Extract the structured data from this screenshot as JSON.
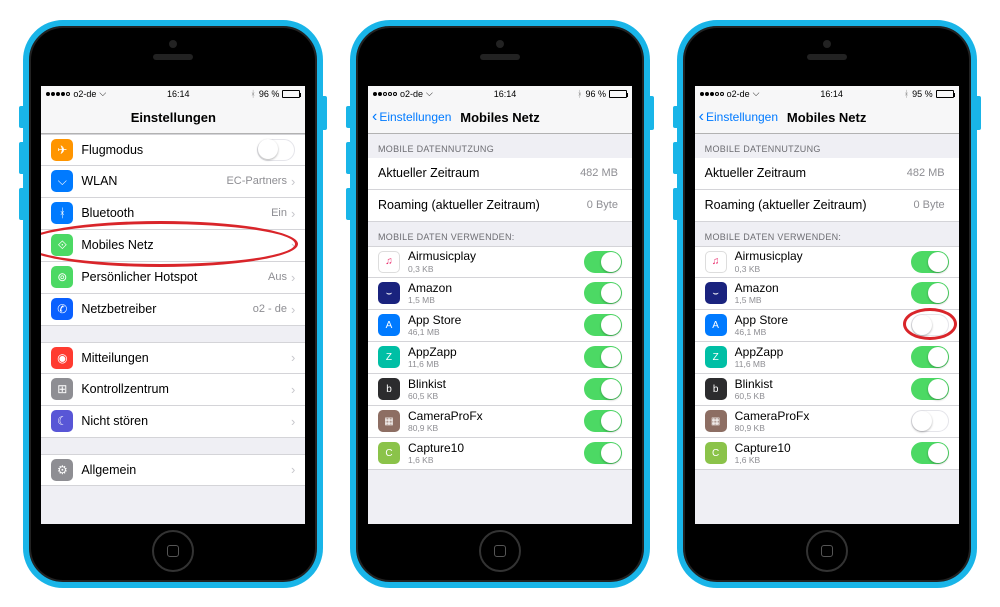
{
  "statusbar": {
    "carrier": "o2-de",
    "time": "16:14",
    "battery1": "96 %",
    "battery3": "95 %",
    "signal1": 4,
    "signal2": 2,
    "signal3": 3
  },
  "phone1": {
    "title": "Einstellungen",
    "rows": {
      "airplane": "Flugmodus",
      "wifi": "WLAN",
      "wifi_value": "EC-Partners",
      "bluetooth": "Bluetooth",
      "bluetooth_value": "Ein",
      "cellular": "Mobiles Netz",
      "hotspot": "Persönlicher Hotspot",
      "hotspot_value": "Aus",
      "carrier": "Netzbetreiber",
      "carrier_value": "o2 - de",
      "notifications": "Mitteilungen",
      "control": "Kontrollzentrum",
      "dnd": "Nicht stören",
      "general": "Allgemein"
    }
  },
  "phone2and3": {
    "back": "Einstellungen",
    "title": "Mobiles Netz",
    "header_usage": "MOBILE DATENNUTZUNG",
    "current_period": "Aktueller Zeitraum",
    "current_value": "482 MB",
    "roaming": "Roaming (aktueller Zeitraum)",
    "roaming_value": "0 Byte",
    "header_use_data": "MOBILE DATEN VERWENDEN:"
  },
  "apps": [
    {
      "name": "Airmusicplay",
      "size": "0,3 KB",
      "color": "ic-white",
      "glyph": "♫"
    },
    {
      "name": "Amazon",
      "size": "1,5 MB",
      "color": "ic-navy",
      "glyph": "⌣"
    },
    {
      "name": "App Store",
      "size": "46,1 MB",
      "color": "ic-blue",
      "glyph": "A"
    },
    {
      "name": "AppZapp",
      "size": "11,6 MB",
      "color": "ic-teal",
      "glyph": "Z"
    },
    {
      "name": "Blinkist",
      "size": "60,5 KB",
      "color": "ic-dark",
      "glyph": "b"
    },
    {
      "name": "CameraProFx",
      "size": "80,9 KB",
      "color": "ic-brown",
      "glyph": "▦"
    },
    {
      "name": "Capture10",
      "size": "1,6 KB",
      "color": "ic-ltgreen",
      "glyph": "C"
    }
  ],
  "phone3_off_apps": [
    "App Store",
    "CameraProFx"
  ]
}
